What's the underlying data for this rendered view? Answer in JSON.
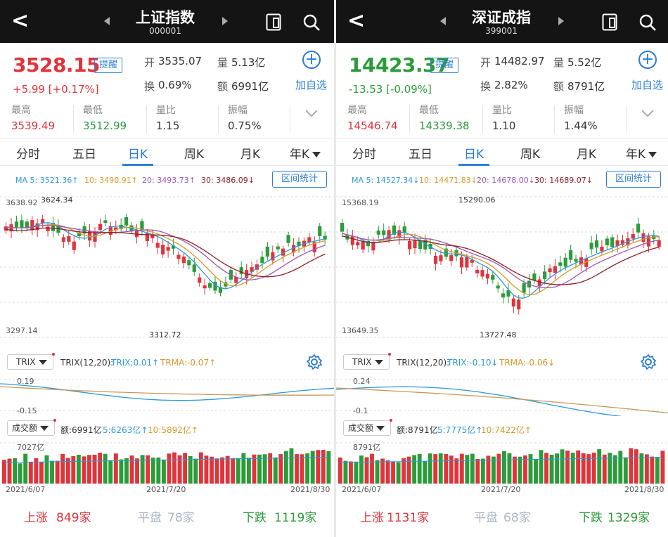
{
  "panels": [
    {
      "id": "pl",
      "header": {
        "title": "上证指数",
        "code": "000001"
      },
      "price": "3528.15",
      "price_color": "up",
      "remind": "提醒",
      "change": "+5.99  [+0.17%]",
      "open_label": "开",
      "open": "3535.07",
      "vol_label": "量",
      "vol": "5.13亿",
      "turn_label": "换",
      "turn": "0.69%",
      "amt_label": "额",
      "amt": "6991亿",
      "add_watch": "加自选",
      "stats": [
        {
          "label": "最高",
          "value": "3539.49",
          "color": "up"
        },
        {
          "label": "最低",
          "value": "3512.99",
          "color": "dn"
        },
        {
          "label": "量比",
          "value": "1.15",
          "color": "neutral"
        },
        {
          "label": "振幅",
          "value": "0.75%",
          "color": "neutral"
        }
      ],
      "tabs": [
        "分时",
        "五日",
        "日K",
        "周K",
        "月K",
        "年K"
      ],
      "active_tab": "日K",
      "ma": {
        "ma5": "MA 5: 3521.36↑",
        "ma10": "10: 3490.91↑",
        "ma20": "20: 3493.73↑",
        "ma30": "30: 3486.09↓"
      },
      "range_btn": "区间统计",
      "k_top": "3638.92",
      "k_bottom": "3297.14",
      "k_hi_mark": "3624.34",
      "k_lo_mark": "3312.72",
      "trix_sel": "TRIX",
      "trix_params": "TRIX(12,20):",
      "trix_val": "TRIX:0.01↑",
      "trma_val": "TRMA:-0.07↑",
      "trix_top": "0.19",
      "trix_bot": "-0.15",
      "vol_sel": "成交额",
      "vol_amt": "额:6991亿",
      "vol_ma5": "5:6263亿↑",
      "vol_ma10": "10:5892亿↑",
      "vol_top": "7027亿",
      "dates": [
        "2021/6/07",
        "2021/7/20",
        "2021/8/30"
      ],
      "footer": {
        "rise_label": "上涨",
        "rise": "849家",
        "flat_label": "平盘",
        "flat": "78家",
        "fall_label": "下跌",
        "fall": "1119家"
      }
    },
    {
      "id": "pr",
      "header": {
        "title": "深证成指",
        "code": "399001"
      },
      "price": "14423.37",
      "price_color": "dn",
      "remind": "提醒",
      "change": "-13.53  [-0.09%]",
      "open_label": "开",
      "open": "14482.97",
      "vol_label": "量",
      "vol": "5.52亿",
      "turn_label": "换",
      "turn": "2.82%",
      "amt_label": "额",
      "amt": "8791亿",
      "add_watch": "加自选",
      "stats": [
        {
          "label": "最高",
          "value": "14546.74",
          "color": "up"
        },
        {
          "label": "最低",
          "value": "14339.38",
          "color": "dn"
        },
        {
          "label": "量比",
          "value": "1.10",
          "color": "neutral"
        },
        {
          "label": "振幅",
          "value": "1.44%",
          "color": "neutral"
        }
      ],
      "tabs": [
        "分时",
        "五日",
        "日K",
        "周K",
        "月K",
        "年K"
      ],
      "active_tab": "日K",
      "ma": {
        "ma5": "MA 5: 14527.34↓",
        "ma10": "10: 14471.83↓",
        "ma20": "20: 14678.00↓",
        "ma30": "30: 14689.07↓"
      },
      "range_btn": "区间统计",
      "k_top": "15368.19",
      "k_bottom": "13649.35",
      "k_hi_mark": "15290.06",
      "k_lo_mark": "13727.48",
      "trix_sel": "TRIX",
      "trix_params": "TRIX(12,20):",
      "trix_val": "TRIX:-0.10↓",
      "trma_val": "TRMA:-0.06↓",
      "trix_top": "0.24",
      "trix_bot": "-0.1",
      "vol_sel": "成交额",
      "vol_amt": "额:8791亿",
      "vol_ma5": "5:7775亿↑",
      "vol_ma10": "10:7422亿↑",
      "vol_top": "8791亿",
      "dates": [
        "2021/6/07",
        "2021/7/20",
        "2021/8/30"
      ],
      "footer": {
        "rise_label": "上涨",
        "rise": "1131家",
        "flat_label": "平盘",
        "flat": "68家",
        "fall_label": "下跌",
        "fall": "1329家"
      }
    }
  ],
  "colors": {
    "up": "#e0343c",
    "down": "#2a9c3a",
    "accent": "#2d7fd4",
    "header_bg": "#141414"
  }
}
